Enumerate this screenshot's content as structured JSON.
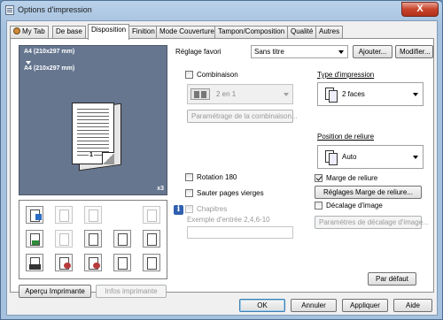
{
  "window": {
    "title": "Options d'impression",
    "close_label": "X"
  },
  "tabs": [
    "My Tab",
    "De base",
    "Disposition",
    "Finition",
    "Mode Couverture",
    "Tampon/Composition",
    "Qualité",
    "Autres"
  ],
  "active_tab": "Disposition",
  "preview": {
    "paper_in": "A4 (210x297 mm)",
    "paper_out": "A4 (210x297 mm)",
    "page_number": "1",
    "copies": "x3"
  },
  "left_buttons": {
    "printer_view": "Aperçu Imprimante",
    "printer_info": "Infos imprimante"
  },
  "favorite": {
    "label": "Réglage favori",
    "value": "Sans titre",
    "add_label": "Ajouter...",
    "modify_label": "Modifier..."
  },
  "combination": {
    "label": "Combinaison",
    "value": "2 en 1",
    "settings_label": "Paramétrage de la combinaison..."
  },
  "print_type": {
    "label": "Type d'impression",
    "value": "2 faces"
  },
  "binding_position": {
    "label": "Position de reliure",
    "value": "Auto"
  },
  "options": {
    "rotation": "Rotation 180",
    "skip_blank": "Sauter pages vierges",
    "chapters": "Chapitres",
    "chapters_example": "Exemple d'entrée 2,4,6-10",
    "binding_margin": "Marge de reliure",
    "binding_margin_settings": "Réglages Marge de reliure...",
    "image_shift": "Décalage d'image",
    "image_shift_settings": "Paramètres de décalage d'image..."
  },
  "default_button": "Par défaut",
  "footer": {
    "ok": "OK",
    "cancel": "Annuler",
    "apply": "Appliquer",
    "help": "Aide"
  }
}
